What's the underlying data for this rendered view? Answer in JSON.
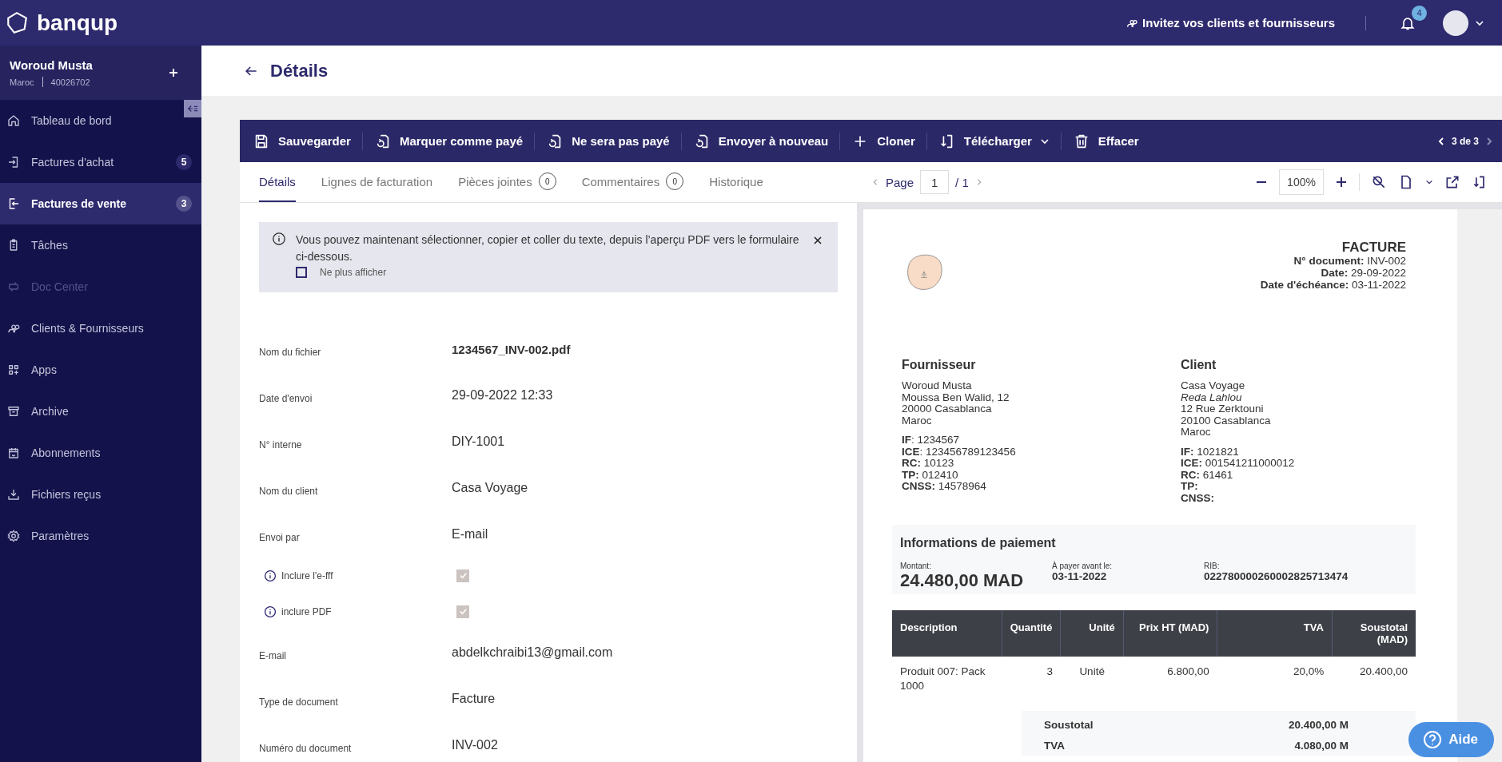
{
  "topbar": {
    "brand": "banqup",
    "invite": "Invitez vos clients et fournisseurs",
    "notifications": "4"
  },
  "account": {
    "name": "Woroud Musta",
    "country": "Maroc",
    "number": "40026702"
  },
  "sidebar": {
    "items": [
      {
        "label": "Tableau de bord",
        "selected": false,
        "disabled": false
      },
      {
        "label": "Factures d'achat",
        "badge": "5",
        "selected": false,
        "disabled": false
      },
      {
        "label": "Factures de vente",
        "badge": "3",
        "selected": true,
        "disabled": false
      },
      {
        "label": "Tâches",
        "selected": false,
        "disabled": false
      },
      {
        "label": "Doc Center",
        "selected": false,
        "disabled": true
      },
      {
        "label": "Clients & Fournisseurs",
        "selected": false,
        "disabled": false
      },
      {
        "label": "Apps",
        "selected": false,
        "disabled": false
      },
      {
        "label": "Archive",
        "selected": false,
        "disabled": false
      },
      {
        "label": "Abonnements",
        "selected": false,
        "disabled": false
      },
      {
        "label": "Fichiers reçus",
        "selected": false,
        "disabled": false
      },
      {
        "label": "Paramètres",
        "selected": false,
        "disabled": false
      }
    ]
  },
  "page_title": "Détails",
  "toolbar": {
    "actions": [
      {
        "label": "Sauvegarder",
        "menu": false
      },
      {
        "label": "Marquer comme payé",
        "menu": false
      },
      {
        "label": "Ne sera pas payé",
        "menu": false
      },
      {
        "label": "Envoyer à nouveau",
        "menu": false
      },
      {
        "label": "Cloner",
        "menu": false
      },
      {
        "label": "Télécharger",
        "menu": true
      },
      {
        "label": "Effacer",
        "menu": false
      }
    ],
    "pager": "3 de 3"
  },
  "tabs": [
    {
      "label": "Détails",
      "selected": true
    },
    {
      "label": "Lignes de facturation",
      "selected": false
    },
    {
      "label": "Pièces jointes",
      "count": "0",
      "selected": false
    },
    {
      "label": "Commentaires",
      "count": "0",
      "selected": false
    },
    {
      "label": "Historique",
      "selected": false
    }
  ],
  "pdf_viewer": {
    "page_label": "Page",
    "page": "1",
    "total": "/ 1",
    "zoom": "100%"
  },
  "notice": {
    "text": "Vous pouvez maintenant sélectionner, copier et coller du texte, depuis l’aperçu PDF vers le formulaire ci-dessous.",
    "dont_show_again": {
      "label": "Ne plus afficher",
      "checked": false
    }
  },
  "fields": [
    {
      "kind": "bold_text",
      "label": "Nom du fichier",
      "value": "1234567_INV-002.pdf"
    },
    {
      "kind": "text",
      "label": "Date d'envoi",
      "value": "29-09-2022 12:33"
    },
    {
      "kind": "text",
      "label": "N° interne",
      "value": "DIY-1001"
    },
    {
      "kind": "text",
      "label": "Nom du client",
      "value": "Casa Voyage"
    },
    {
      "kind": "text",
      "label": "Envoi par",
      "value": "E-mail"
    },
    {
      "kind": "checkbox",
      "label": "Inclure l'e-fff",
      "checked": true
    },
    {
      "kind": "checkbox",
      "label": "inclure PDF",
      "checked": true
    },
    {
      "kind": "text",
      "label": "E-mail",
      "value": "abdelkchraibi13@gmail.com"
    },
    {
      "kind": "text",
      "label": "Type de document",
      "value": "Facture"
    },
    {
      "kind": "text",
      "label": "Numéro du document",
      "value": "INV-002"
    }
  ],
  "invoice": {
    "title": "FACTURE",
    "meta": [
      "**N° document:** INV-002",
      "**Date:** 29-09-2022",
      "**Date d'échéance:** 03-11-2022"
    ],
    "parties": [
      {
        "heading": "Fournisseur",
        "address": [
          "Woroud Musta",
          "Moussa Ben Walid, 12",
          "20000 Casablanca",
          "Maroc"
        ],
        "ids": [
          "**IF**: 1234567",
          "**ICE**: 123456789123456",
          "**RC:** 10123",
          "**TP:** 012410",
          "**CNSS:** 14578964"
        ]
      },
      {
        "heading": "Client",
        "address": [
          "Casa Voyage",
          "*Reda Lahlou*",
          "12 Rue Zerktouni",
          "20100 Casablanca",
          "Maroc"
        ],
        "ids": [
          "**IF:** 1021821",
          "**ICE:** 001541211000012",
          "**RC:** 61461",
          "**TP:**",
          "**CNSS:**"
        ]
      }
    ],
    "payment": {
      "heading": "Informations de paiement",
      "amount_label": "Montant:",
      "amount": "24.480,00 MAD",
      "due_label": "À payer avant le:",
      "due": "03-11-2022",
      "rib_label": "RIB:",
      "rib": "022780000260002825713474"
    },
    "table": {
      "columns": [
        "Description",
        "Quantité",
        "Unité",
        "Prix HT (MAD)",
        "TVA",
        "Soustotal (MAD)"
      ],
      "rows": [
        [
          "Produit 007: Pack 1000",
          "3",
          "Unité",
          "6.800,00",
          "20,0%",
          "20.400,00"
        ]
      ]
    },
    "totals": [
      {
        "label": "Soustotal",
        "value": "20.400,00 M"
      },
      {
        "label": "TVA",
        "value": "4.080,00 M"
      }
    ]
  },
  "help_button": "Aide"
}
